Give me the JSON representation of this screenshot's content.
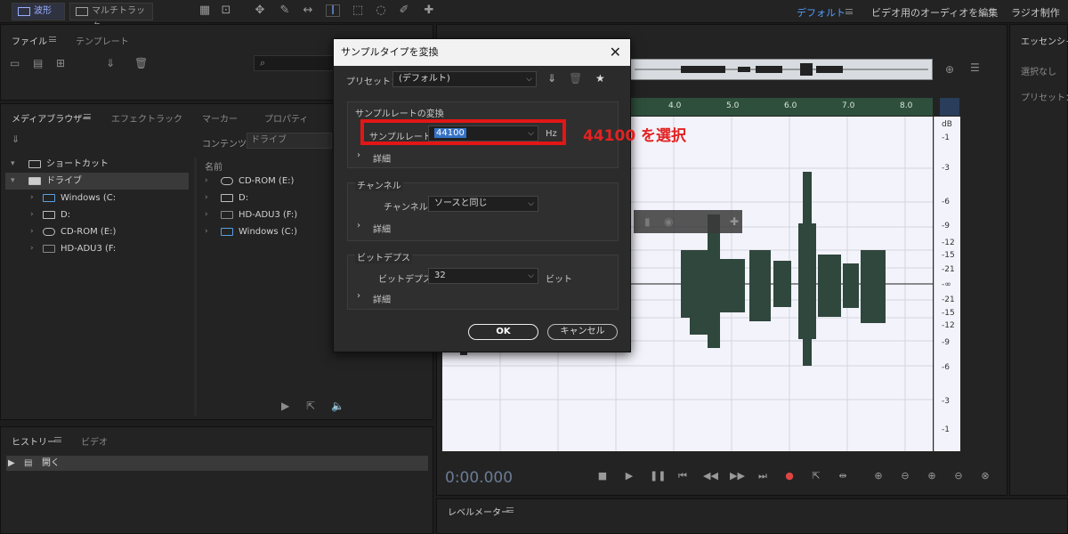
{
  "toolbar": {
    "waveform_label": "波形",
    "multitrack_label": "マルチトラック",
    "workspace_default": "デフォルト",
    "workspace_video": "ビデオ用のオーディオを編集",
    "workspace_radio": "ラジオ制作"
  },
  "files_panel": {
    "tab_files": "ファイル",
    "tab_templates": "テンプレート"
  },
  "media_browser": {
    "tab_media": "メディアブラウザー",
    "tab_effects": "エフェクトラック",
    "tab_markers": "マーカー",
    "tab_properties": "プロパティ",
    "contents_label": "コンテンツ：",
    "contents_value": "ドライブ",
    "tree": [
      {
        "label": "ショートカット"
      },
      {
        "label": "ドライブ"
      },
      {
        "label": "Windows (C:"
      },
      {
        "label": "D:"
      },
      {
        "label": "CD-ROM (E:)"
      },
      {
        "label": "HD-ADU3 (F:"
      }
    ],
    "column_name": "名前",
    "list": [
      {
        "label": "CD-ROM (E:)"
      },
      {
        "label": "D:"
      },
      {
        "label": "HD-ADU3 (F:)"
      },
      {
        "label": "Windows (C:)"
      }
    ]
  },
  "history_panel": {
    "tab_history": "ヒストリー",
    "tab_video": "ビデオ",
    "item_open": "開く"
  },
  "editor": {
    "ruler_labels": [
      "4.0",
      "5.0",
      "6.0",
      "7.0",
      "8.0"
    ],
    "db_labels": [
      "dB",
      "-1",
      "-3",
      "-6",
      "-9",
      "-12",
      "-15",
      "-21",
      "-∞",
      "-21",
      "-15",
      "-12",
      "-9",
      "-6",
      "-3",
      "-1"
    ],
    "timecode": "0:00.000"
  },
  "essential_panel": {
    "title": "エッセンシャル",
    "none_label": "選択なし",
    "preset_label": "プリセット："
  },
  "level_meter": {
    "title": "レベルメーター"
  },
  "dialog": {
    "title": "サンプルタイプを変換",
    "preset_label": "プリセット：",
    "preset_value": "(デフォルト)",
    "sample_rate_group": "サンプルレートの変換",
    "sample_rate_label": "サンプルレート：",
    "sample_rate_value": "44100",
    "sample_rate_unit": "Hz",
    "details_label": "詳細",
    "channel_group": "チャンネル",
    "channel_label": "チャンネル：",
    "channel_value": "ソースと同じ",
    "bit_depth_group": "ビットデプス",
    "bit_depth_label": "ビットデプス：",
    "bit_depth_value": "32",
    "bit_depth_unit": "ビット",
    "ok_label": "OK",
    "cancel_label": "キャンセル"
  },
  "annotation": {
    "text": "44100 を選択",
    "color": "#e22222"
  }
}
